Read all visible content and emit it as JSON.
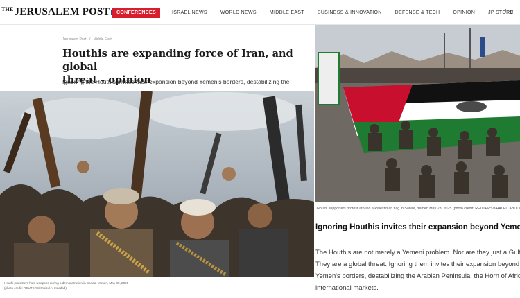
{
  "brand": {
    "name": "JERUSALEM POST",
    "prefix": "THE"
  },
  "nav": {
    "items": [
      "CONFERENCES",
      "ISRAEL NEWS",
      "WORLD NEWS",
      "MIDDLE EAST",
      "BUSINESS & INNOVATION",
      "DEFENSE & TECH",
      "OPINION",
      "JP STORE"
    ],
    "login": "Log"
  },
  "colors": {
    "accent": "#d81e2c",
    "brand_blue": "#1c4aa8",
    "flag_green": "#1f7a32",
    "flag_red": "#c8102e"
  },
  "left_article": {
    "breadcrumbs": [
      "Jerusalem Post",
      "Middle East"
    ],
    "breadcrumb_sep": "/",
    "headline_line1": "Houthis are expanding force of Iran, and global",
    "headline_line2": "threat - opinion",
    "subhead": "Ignoring the Houthis invites their expansion beyond Yemen's borders, destabilizing the",
    "caption_line1": "Houthi protesters hold weapons during a demonstration in Sanaa, Yemen, May 30, 2025",
    "caption_line2": "(photo credit: REUTERS/Khaled Al-Haddad)"
  },
  "right_article": {
    "caption": "Houthi supporters protest around a Palestinian flag in Sanaa, Yemen May 23, 2025 (photo credit: REUTERS/KHALED ABDULLAH",
    "title": "Ignoring Houthis invites their expansion beyond Yemeni borders",
    "body": [
      "The Houthis are not merely a Yemeni problem. Nor are they just a Gulf issue.",
      "They are a global threat. Ignoring them invites their expansion beyond",
      "Yemen's borders, destabilizing the Arabian Peninsula, the Horn of Africa, and",
      "international markets."
    ]
  }
}
